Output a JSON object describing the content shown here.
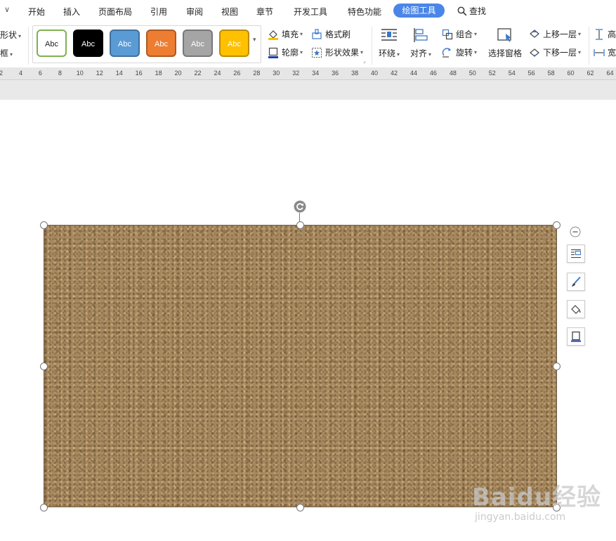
{
  "menubar": {
    "dropdown_glyph": "∨",
    "items": [
      "开始",
      "插入",
      "页面布局",
      "引用",
      "审阅",
      "视图",
      "章节",
      "开发工具",
      "特色功能"
    ],
    "active_tab": "绘图工具",
    "search_label": "查找"
  },
  "ribbon": {
    "left_partial": {
      "shape_label": "形状",
      "frame_label": "框"
    },
    "style_swatches": [
      {
        "label": "Abc",
        "fill": "#ffffff",
        "border": "#7fb24f",
        "text": "#222222"
      },
      {
        "label": "Abc",
        "fill": "#000000",
        "border": "#000000",
        "text": "#ffffff"
      },
      {
        "label": "Abc",
        "fill": "#5b9bd5",
        "border": "#41719c",
        "text": "#ffffff"
      },
      {
        "label": "Abc",
        "fill": "#ed7d31",
        "border": "#ae5a21",
        "text": "#ffffff"
      },
      {
        "label": "Abc",
        "fill": "#a5a5a5",
        "border": "#787878",
        "text": "#ffffff"
      },
      {
        "label": "Abc",
        "fill": "#ffc000",
        "border": "#bc8c00",
        "text": "#ffffff"
      }
    ],
    "fill_label": "填充",
    "outline_label": "轮廓",
    "format_painter_label": "格式刷",
    "shape_effect_label": "形状效果",
    "wrap_label": "环绕",
    "align_label": "对齐",
    "group_label": "组合",
    "rotate_label": "旋转",
    "selection_pane_label": "选择窗格",
    "bring_forward_label": "上移一层",
    "send_backward_label": "下移一层",
    "height_label_partial": "高",
    "width_label_partial": "宽"
  },
  "ruler": {
    "numbers": [
      "2",
      "4",
      "6",
      "8",
      "10",
      "12",
      "14",
      "16",
      "18",
      "20",
      "22",
      "24",
      "26",
      "28",
      "30",
      "32",
      "34",
      "36",
      "38",
      "40",
      "42",
      "44",
      "46",
      "48",
      "50",
      "52",
      "54",
      "56",
      "58",
      "60",
      "62",
      "64"
    ]
  },
  "canvas": {
    "shape_fill": "sand-texture",
    "side_tools": [
      "layout-options-icon",
      "shape-style-icon",
      "shape-fill-icon",
      "shape-outline-icon"
    ]
  },
  "watermark": {
    "brand": "Baidu经验",
    "url": "jingyan.baidu.com"
  },
  "colors": {
    "accent": "#4a86e8",
    "ruler_bg": "#e6e6e6",
    "texture_base": "#a8895f"
  }
}
